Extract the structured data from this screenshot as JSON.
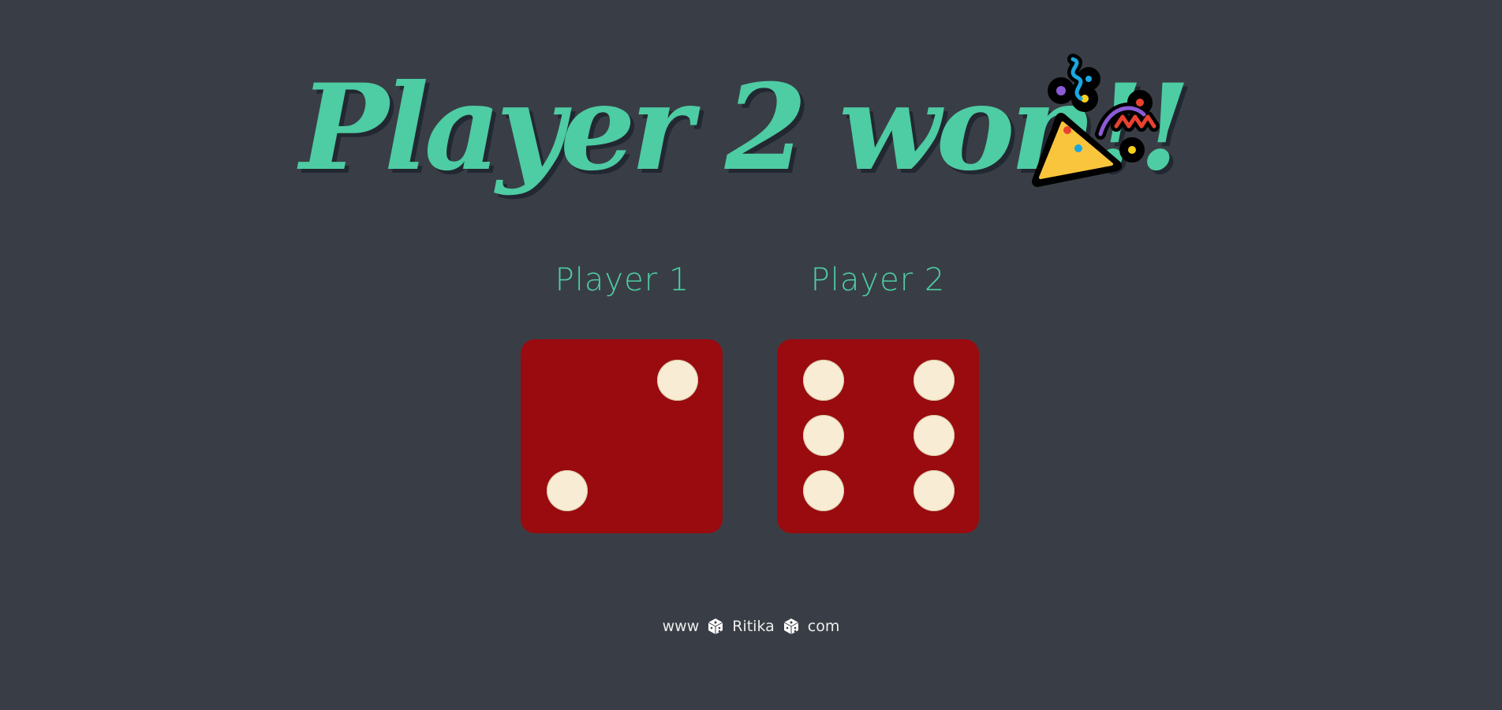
{
  "headline": {
    "text": "Player 2 won!!",
    "icon": "party-popper-icon"
  },
  "players": [
    {
      "label": "Player 1",
      "die_value": 2
    },
    {
      "label": "Player 2",
      "die_value": 6
    }
  ],
  "footer": {
    "prefix": "www",
    "name": "Ritika",
    "suffix": "com",
    "separator_icon": "dice-icon"
  },
  "colors": {
    "background": "#393e46",
    "accent": "#4ecca3",
    "die_face": "#990b0e",
    "pip": "#f8ecd4",
    "footer_text": "#eeeeee"
  }
}
